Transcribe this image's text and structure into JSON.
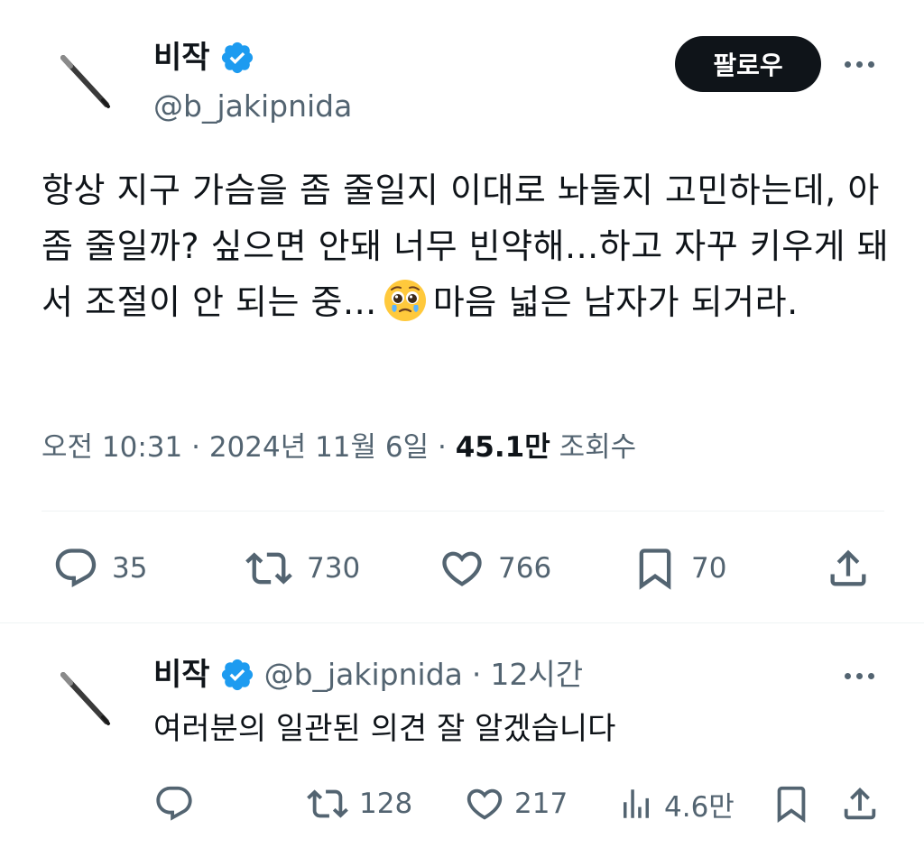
{
  "tweet": {
    "author_name": "비작",
    "handle": "@b_jakipnida",
    "follow_label": "팔로우",
    "text": {
      "before_emoji": "항상 지구 가슴을 좀 줄일지 이대로 놔둘지 고민하는데, 아 좀 줄일까? 싶으면 안돼 너무 빈약해...하고 자꾸 키우게 돼서 조절이 안 되는 중...",
      "after_emoji": "마음 넓은 남자가 되거라."
    },
    "time": "오전 10:31",
    "date": "2024년 11월 6일",
    "views_count": "45.1만",
    "views_label": "조회수",
    "stats": {
      "replies": "35",
      "retweets": "730",
      "likes": "766",
      "bookmarks": "70"
    }
  },
  "reply": {
    "author_name": "비작",
    "handle": "@b_jakipnida",
    "time_ago": "12시간",
    "text": "여러분의 일관된 의견 잘 알겠습니다",
    "stats": {
      "retweets": "128",
      "likes": "217",
      "views": "4.6만"
    }
  },
  "icons": {
    "verified": "verified-badge-icon",
    "emoji": "pleading-face-emoji-icon",
    "reply": "reply-icon",
    "retweet": "retweet-icon",
    "like": "heart-icon",
    "bookmark": "bookmark-icon",
    "share": "share-icon",
    "views": "views-bar-chart-icon",
    "more": "more-dots-icon"
  },
  "colors": {
    "verified_blue": "#1d9bf0",
    "text_primary": "#0f1419",
    "text_secondary": "#536471",
    "follow_button_bg": "#0f1419"
  }
}
